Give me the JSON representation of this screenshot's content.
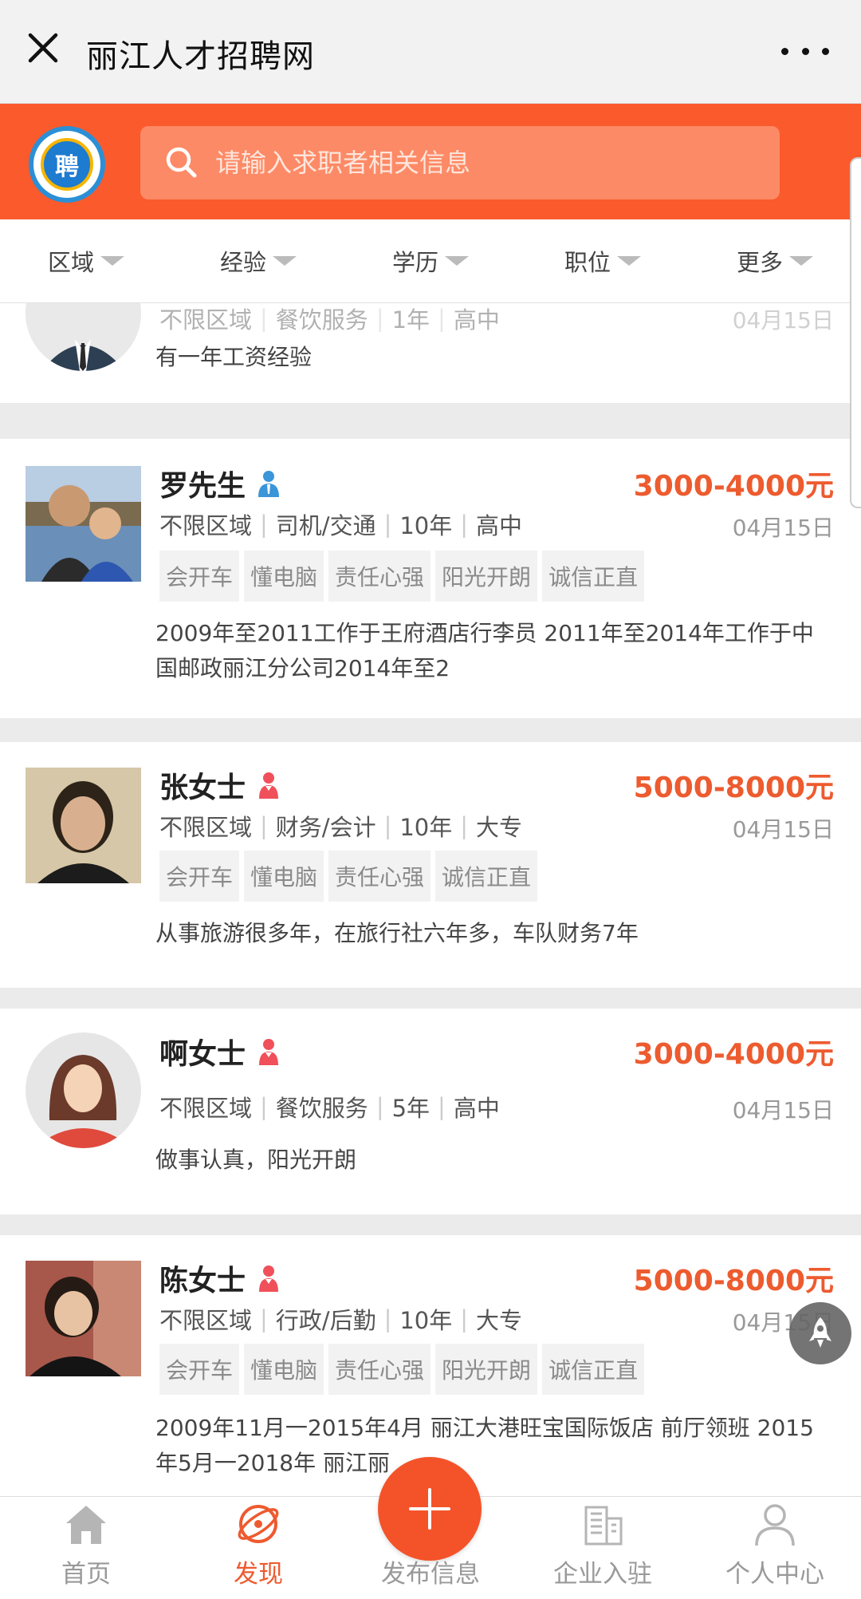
{
  "app": {
    "title": "丽江人才招聘网"
  },
  "header": {
    "logo_text": "聘",
    "search_placeholder": "请输入求职者相关信息"
  },
  "filters": [
    "区域",
    "经验",
    "学历",
    "职位",
    "更多"
  ],
  "partial_card": {
    "meta": [
      "不限区域",
      "餐饮服务",
      "1年",
      "高中"
    ],
    "date": "04月15日",
    "desc": "有一年工资经验"
  },
  "cards": [
    {
      "name": "罗先生",
      "gender": "male",
      "salary": "3000-4000元",
      "meta": [
        "不限区域",
        "司机/交通",
        "10年",
        "高中"
      ],
      "date": "04月15日",
      "tags": [
        "会开车",
        "懂电脑",
        "责任心强",
        "阳光开朗",
        "诚信正直"
      ],
      "desc": "2009年至2011工作于王府酒店行李员 2011年至2014年工作于中国邮政丽江分公司2014年至2"
    },
    {
      "name": "张女士",
      "gender": "female",
      "salary": "5000-8000元",
      "meta": [
        "不限区域",
        "财务/会计",
        "10年",
        "大专"
      ],
      "date": "04月15日",
      "tags": [
        "会开车",
        "懂电脑",
        "责任心强",
        "诚信正直"
      ],
      "desc": "从事旅游很多年，在旅行社六年多，车队财务7年"
    },
    {
      "name": "啊女士",
      "gender": "female",
      "salary": "3000-4000元",
      "meta": [
        "不限区域",
        "餐饮服务",
        "5年",
        "高中"
      ],
      "date": "04月15日",
      "tags": [],
      "desc": "做事认真，阳光开朗"
    },
    {
      "name": "陈女士",
      "gender": "female",
      "salary": "5000-8000元",
      "meta": [
        "不限区域",
        "行政/后勤",
        "10年",
        "大专"
      ],
      "date": "04月15日",
      "tags": [
        "会开车",
        "懂电脑",
        "责任心强",
        "阳光开朗",
        "诚信正直"
      ],
      "desc": "2009年11月一2015年4月 丽江大港旺宝国际饭店 前厅领班 2015年5月一2018年 丽江丽"
    }
  ],
  "bottom_nav": [
    "首页",
    "发现",
    "发布信息",
    "企业入驻",
    "个人中心"
  ],
  "colors": {
    "brand": "#fb5a2c",
    "salary": "#ed5b2f",
    "active_nav": "#ee5a2f"
  }
}
